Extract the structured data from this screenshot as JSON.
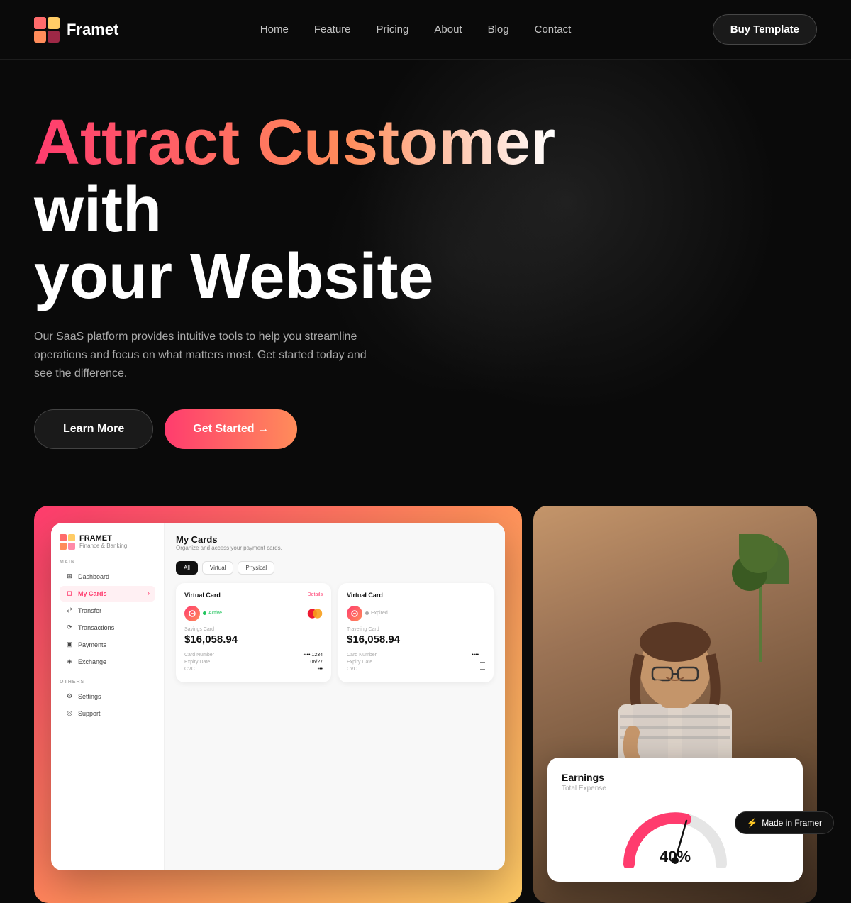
{
  "nav": {
    "logo_text": "Framet",
    "links": [
      "Home",
      "Feature",
      "Pricing",
      "About",
      "Blog",
      "Contact"
    ],
    "buy_button": "Buy Template"
  },
  "hero": {
    "title_line1_colored": "Attract Customer",
    "title_line1_white": " with",
    "title_line2": "your Website",
    "subtitle": "Our SaaS platform provides intuitive tools to help you streamline operations and focus on what matters most. Get started today and see the difference.",
    "learn_more": "Learn More",
    "get_started": "Get Started →"
  },
  "app_mockup": {
    "sidebar": {
      "brand": "FRAMET",
      "sub": "Finance & Banking",
      "sections": [
        {
          "label": "MAIN",
          "items": [
            {
              "icon": "⊞",
              "label": "Dashboard",
              "active": false
            },
            {
              "icon": "◻",
              "label": "My Cards",
              "active": true
            },
            {
              "icon": "⇄",
              "label": "Transfer",
              "active": false
            },
            {
              "icon": "⟳",
              "label": "Transactions",
              "active": false
            },
            {
              "icon": "▣",
              "label": "Payments",
              "active": false
            },
            {
              "icon": "◈",
              "label": "Exchange",
              "active": false
            }
          ]
        },
        {
          "label": "OTHERS",
          "items": [
            {
              "icon": "⚙",
              "label": "Settings",
              "active": false
            },
            {
              "icon": "◎",
              "label": "Support",
              "active": false
            }
          ]
        }
      ]
    },
    "main": {
      "title": "My Cards",
      "subtitle": "Organize and access your payment cards.",
      "tabs": [
        "All",
        "Virtual",
        "Physical"
      ],
      "active_tab": "All",
      "cards": [
        {
          "type": "Virtual Card",
          "action": "Details",
          "status": "Active",
          "card_name": "Savings Card",
          "amount": "$16,058.94",
          "card_number": "•••• 1234",
          "expiry": "06/27",
          "cvc": "•••"
        },
        {
          "type": "Virtual Card",
          "status": "Expired",
          "card_name": "Traveling Card",
          "amount": "$16,058.94",
          "card_number": "•••• —",
          "expiry": "—",
          "cvc": "—"
        }
      ]
    }
  },
  "earnings": {
    "title": "Earnings",
    "subtitle": "Total Expense",
    "percentage": "40%"
  },
  "badge": {
    "icon": "⚡",
    "text": "Made in Framer"
  }
}
